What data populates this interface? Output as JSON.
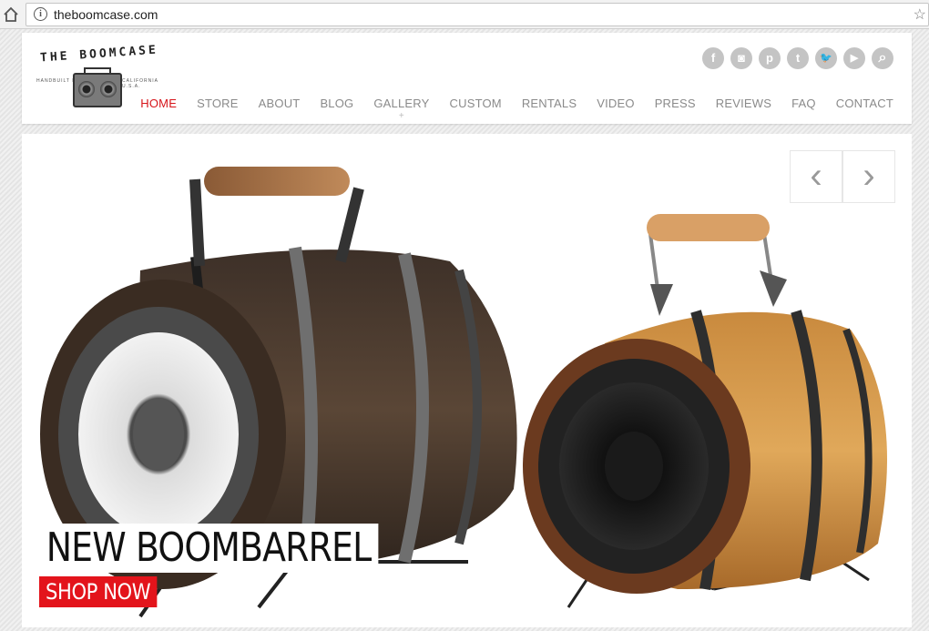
{
  "browser": {
    "url": "theboomcase.com"
  },
  "logo": {
    "text": "THE BOOMCASE",
    "sub_left": "HANDBUILT IN",
    "sub_right": "CALIFORNIA U.S.A."
  },
  "social": [
    {
      "icon": "facebook-icon",
      "glyph": "f"
    },
    {
      "icon": "instagram-icon",
      "glyph": "◙"
    },
    {
      "icon": "pinterest-icon",
      "glyph": "p"
    },
    {
      "icon": "tumblr-icon",
      "glyph": "t"
    },
    {
      "icon": "twitter-icon",
      "glyph": "🐦"
    },
    {
      "icon": "youtube-icon",
      "glyph": "▶"
    },
    {
      "icon": "search-icon",
      "glyph": "⌕"
    }
  ],
  "nav": {
    "items": [
      "HOME",
      "STORE",
      "ABOUT",
      "BLOG",
      "GALLERY",
      "CUSTOM",
      "RENTALS",
      "VIDEO",
      "PRESS",
      "REVIEWS",
      "FAQ",
      "CONTACT"
    ],
    "active_color": "#d6141a",
    "gallery_plus": "+"
  },
  "slider": {
    "prev": "‹",
    "next": "›",
    "caption": "NEW BOOMBARREL",
    "cta": "SHOP NOW",
    "cta_color": "#e3141b"
  }
}
